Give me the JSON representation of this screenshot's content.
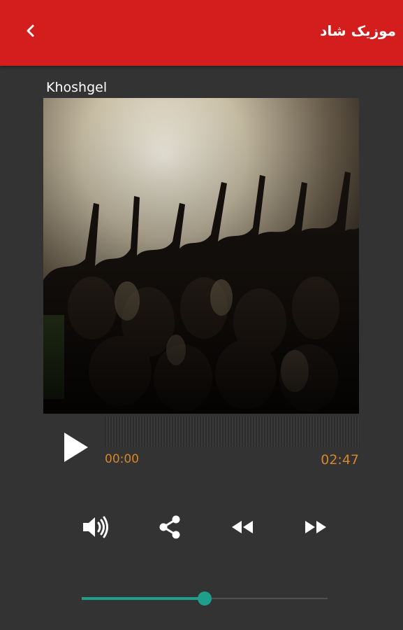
{
  "header": {
    "title": "موزیک شاد",
    "back_icon": "chevron-left-icon"
  },
  "player": {
    "song_title": "Khoshgel",
    "current_time": "00:00",
    "total_time": "02:47",
    "play_icon": "play-icon",
    "volume_fraction": 0.5
  },
  "controls": [
    {
      "name": "volume",
      "icon": "volume-icon"
    },
    {
      "name": "share",
      "icon": "share-icon"
    },
    {
      "name": "rewind",
      "icon": "rewind-icon"
    },
    {
      "name": "fast-forward",
      "icon": "fast-forward-icon"
    }
  ],
  "colors": {
    "header": "#d41e1e",
    "background": "#333333",
    "time_text": "#d4862a",
    "slider_accent": "#1f9e8c"
  }
}
